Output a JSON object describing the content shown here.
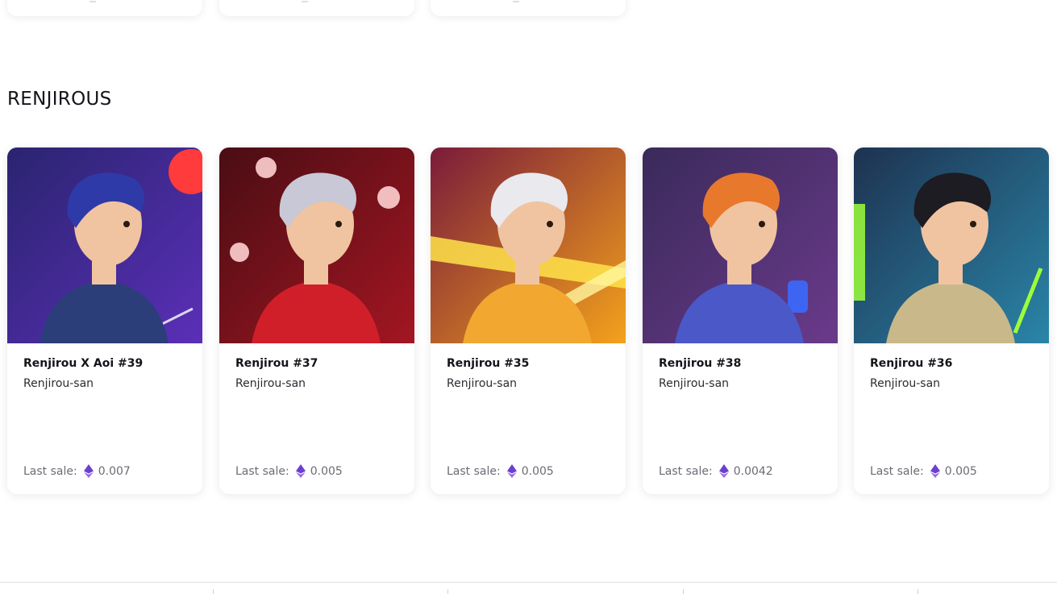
{
  "section": {
    "title": "RENJIROUS"
  },
  "cards": [
    {
      "name": "Renjirou X Aoi #39",
      "creator": "Renjirou-san",
      "last_sale_label": "Last sale:",
      "price": "0.007",
      "art_icon": "samurai-blue-hair-art",
      "bg": [
        "#2a2470",
        "#5b2fb8"
      ],
      "accent": "#ff3b3b"
    },
    {
      "name": "Renjirou #37",
      "creator": "Renjirou-san",
      "last_sale_label": "Last sale:",
      "price": "0.005",
      "art_icon": "red-jacket-skulls-art",
      "bg": [
        "#4a0d14",
        "#a31622"
      ],
      "accent": "#ff6b6b"
    },
    {
      "name": "Renjirou #35",
      "creator": "Renjirou-san",
      "last_sale_label": "Last sale:",
      "price": "0.005",
      "art_icon": "visor-light-beams-art",
      "bg": [
        "#7a1b3a",
        "#f3a21c"
      ],
      "accent": "#ffe34a"
    },
    {
      "name": "Renjirou #38",
      "creator": "Renjirou-san",
      "last_sale_label": "Last sale:",
      "price": "0.0042",
      "art_icon": "headphones-blue-hoodie-art",
      "bg": [
        "#3a2a5a",
        "#6a3a8a"
      ],
      "accent": "#f07ad8"
    },
    {
      "name": "Renjirou #36",
      "creator": "Renjirou-san",
      "last_sale_label": "Last sale:",
      "price": "0.005",
      "art_icon": "camo-helmet-gun-art",
      "bg": [
        "#1e3250",
        "#2a85a8"
      ],
      "accent": "#9cff3a"
    }
  ],
  "colors": {
    "eth": "#6c3fd1",
    "text": "#14151a",
    "muted": "#6b6c74"
  }
}
